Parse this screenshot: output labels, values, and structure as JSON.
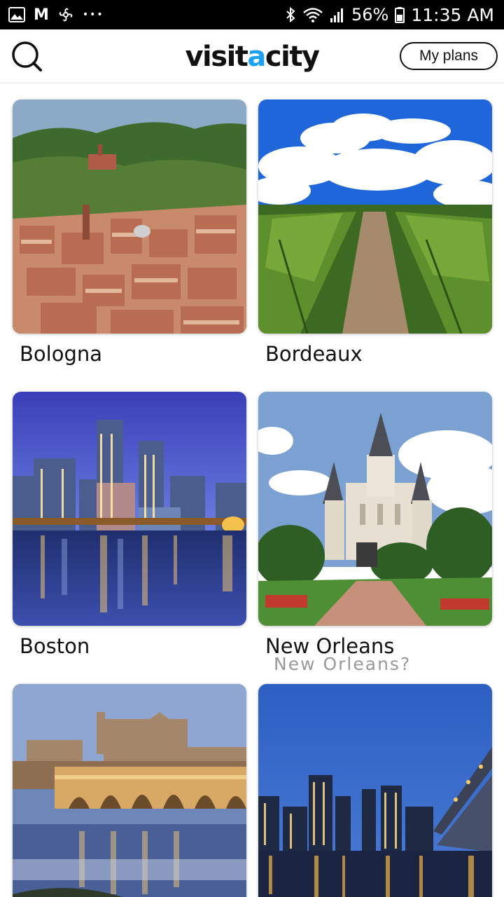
{
  "status_bar": {
    "left_icons": [
      "image-icon",
      "gmail-icon",
      "pinwheel-icon",
      "more-dots-icon"
    ],
    "gmail_letter": "M",
    "dots": "•••",
    "battery": "56%",
    "time": "11:35 AM"
  },
  "header": {
    "logo_part1": "visit",
    "logo_part2": "a",
    "logo_part3": "city",
    "plans_label": "My plans",
    "accent_color": "#1da1f2"
  },
  "cities": [
    {
      "name": "Bologna"
    },
    {
      "name": "Bordeaux"
    },
    {
      "name": "Boston"
    },
    {
      "name": "New Orleans",
      "overlay_text": "New Orleans?"
    },
    {
      "name": ""
    },
    {
      "name": ""
    }
  ]
}
